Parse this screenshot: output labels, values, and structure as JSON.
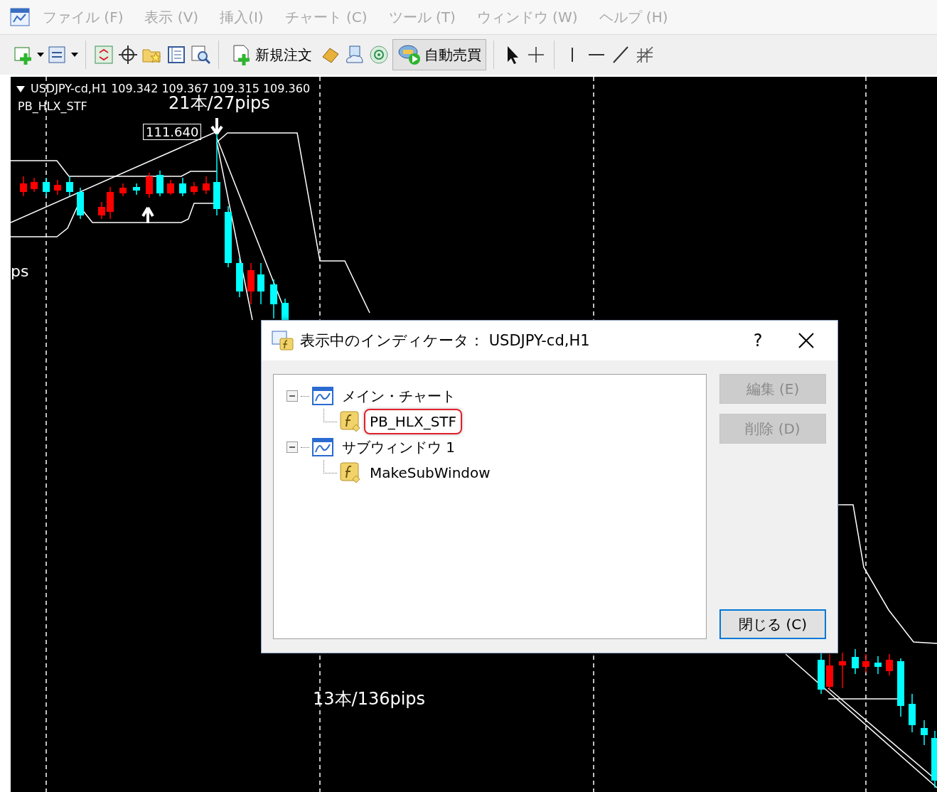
{
  "menu_bar": {
    "items": [
      {
        "label": "ファイル (F)",
        "disabled": true
      },
      {
        "label": "表示 (V)",
        "disabled": true
      },
      {
        "label": "挿入(I)",
        "disabled": true
      },
      {
        "label": "チャート (C)",
        "disabled": true
      },
      {
        "label": "ツール (T)",
        "disabled": true
      },
      {
        "label": "ウィンドウ (W)",
        "disabled": true
      },
      {
        "label": "ヘルプ (H)",
        "disabled": true
      }
    ]
  },
  "toolbar": {
    "order_button": "新規注文",
    "auto_trading": {
      "label": "自動売買",
      "on": true
    }
  },
  "chart": {
    "symbol_info": "USDJPY-cd,H1  109.342 109.367 109.315 109.360",
    "indicator": "PB_HLX_STF",
    "labels": [
      {
        "kind": "text",
        "text": "21本/27pips"
      },
      {
        "kind": "price_box",
        "text": "111.640"
      },
      {
        "kind": "text",
        "text": "ps"
      },
      {
        "kind": "text",
        "text": "13本/136pips"
      }
    ]
  },
  "dialog": {
    "title": "表示中のインディケータ： USDJPY-cd,H1",
    "help": "?",
    "tree": [
      {
        "label": "メイン・チャート",
        "kind": "window",
        "expanded": true,
        "children": [
          {
            "label": "PB_HLX_STF",
            "kind": "indicator",
            "highlighted": true
          }
        ]
      },
      {
        "label": "サブウィンドウ 1",
        "kind": "window",
        "expanded": true,
        "children": [
          {
            "label": "MakeSubWindow",
            "kind": "indicator",
            "highlighted": false
          }
        ]
      }
    ],
    "buttons": [
      {
        "label": "編集 (E)",
        "disabled": true,
        "default": false
      },
      {
        "label": "削除 (D)",
        "disabled": true,
        "default": false
      },
      {
        "label": "閉じる (C)",
        "disabled": false,
        "default": true
      }
    ]
  }
}
